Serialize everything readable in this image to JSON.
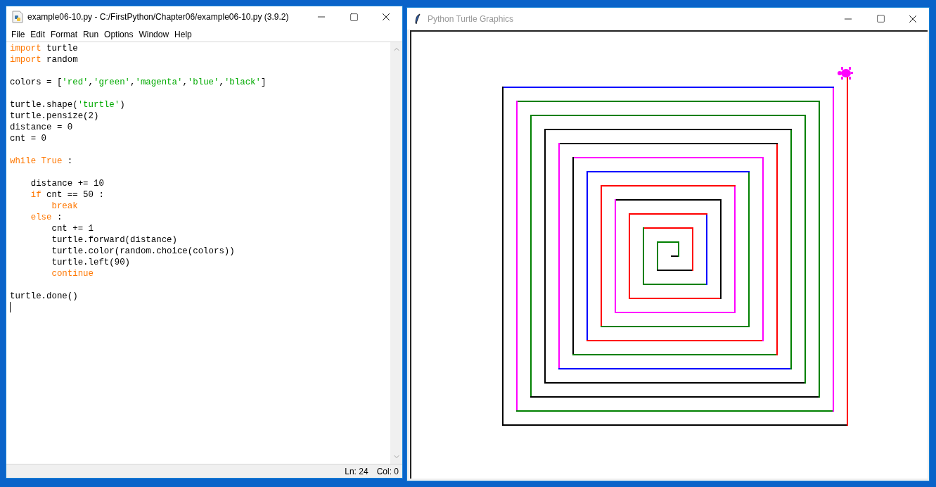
{
  "editor": {
    "title": "example06-10.py - C:/FirstPython/Chapter06/example06-10.py (3.9.2)",
    "menu": [
      "File",
      "Edit",
      "Format",
      "Run",
      "Options",
      "Window",
      "Help"
    ],
    "blocks": [
      [
        [
          {
            "kind": "keyword",
            "text": "import"
          },
          {
            "kind": "plain",
            "text": " turtle"
          }
        ],
        [
          {
            "kind": "keyword",
            "text": "import"
          },
          {
            "kind": "plain",
            "text": " random"
          }
        ]
      ],
      [
        [
          {
            "kind": "plain",
            "text": "colors = ["
          },
          {
            "kind": "string",
            "text": "'red'"
          },
          {
            "kind": "plain",
            "text": ","
          },
          {
            "kind": "string",
            "text": "'green'"
          },
          {
            "kind": "plain",
            "text": ","
          },
          {
            "kind": "string",
            "text": "'magenta'"
          },
          {
            "kind": "plain",
            "text": ","
          },
          {
            "kind": "string",
            "text": "'blue'"
          },
          {
            "kind": "plain",
            "text": ","
          },
          {
            "kind": "string",
            "text": "'black'"
          },
          {
            "kind": "plain",
            "text": "]"
          }
        ]
      ],
      [
        [
          {
            "kind": "plain",
            "text": "turtle.shape("
          },
          {
            "kind": "string",
            "text": "'turtle'"
          },
          {
            "kind": "plain",
            "text": ")"
          }
        ],
        [
          {
            "kind": "plain",
            "text": "turtle.pensize(2)"
          }
        ],
        [
          {
            "kind": "plain",
            "text": "distance = 0"
          }
        ],
        [
          {
            "kind": "plain",
            "text": "cnt = 0"
          }
        ]
      ],
      [
        [
          {
            "kind": "keyword",
            "text": "while True"
          },
          {
            "kind": "plain",
            "text": " :"
          }
        ]
      ],
      [
        [
          {
            "kind": "plain",
            "text": "    distance += 10"
          }
        ],
        [
          {
            "kind": "keyword",
            "text": "    if"
          },
          {
            "kind": "plain",
            "text": " cnt == 50 :"
          }
        ],
        [
          {
            "kind": "keyword",
            "text": "        break"
          }
        ],
        [
          {
            "kind": "keyword",
            "text": "    else"
          },
          {
            "kind": "plain",
            "text": " :"
          }
        ],
        [
          {
            "kind": "plain",
            "text": "        cnt += 1"
          }
        ],
        [
          {
            "kind": "plain",
            "text": "        turtle.forward(distance)"
          }
        ],
        [
          {
            "kind": "plain",
            "text": "        turtle.color(random.choice(colors))"
          }
        ],
        [
          {
            "kind": "plain",
            "text": "        turtle.left(90)"
          }
        ],
        [
          {
            "kind": "keyword",
            "text": "        continue"
          }
        ]
      ],
      [
        [
          {
            "kind": "plain",
            "text": "turtle.done()"
          }
        ]
      ]
    ],
    "status": {
      "line": "Ln: 24",
      "column": "Col: 0"
    }
  },
  "turtle_window": {
    "title": "Python Turtle Graphics"
  }
}
